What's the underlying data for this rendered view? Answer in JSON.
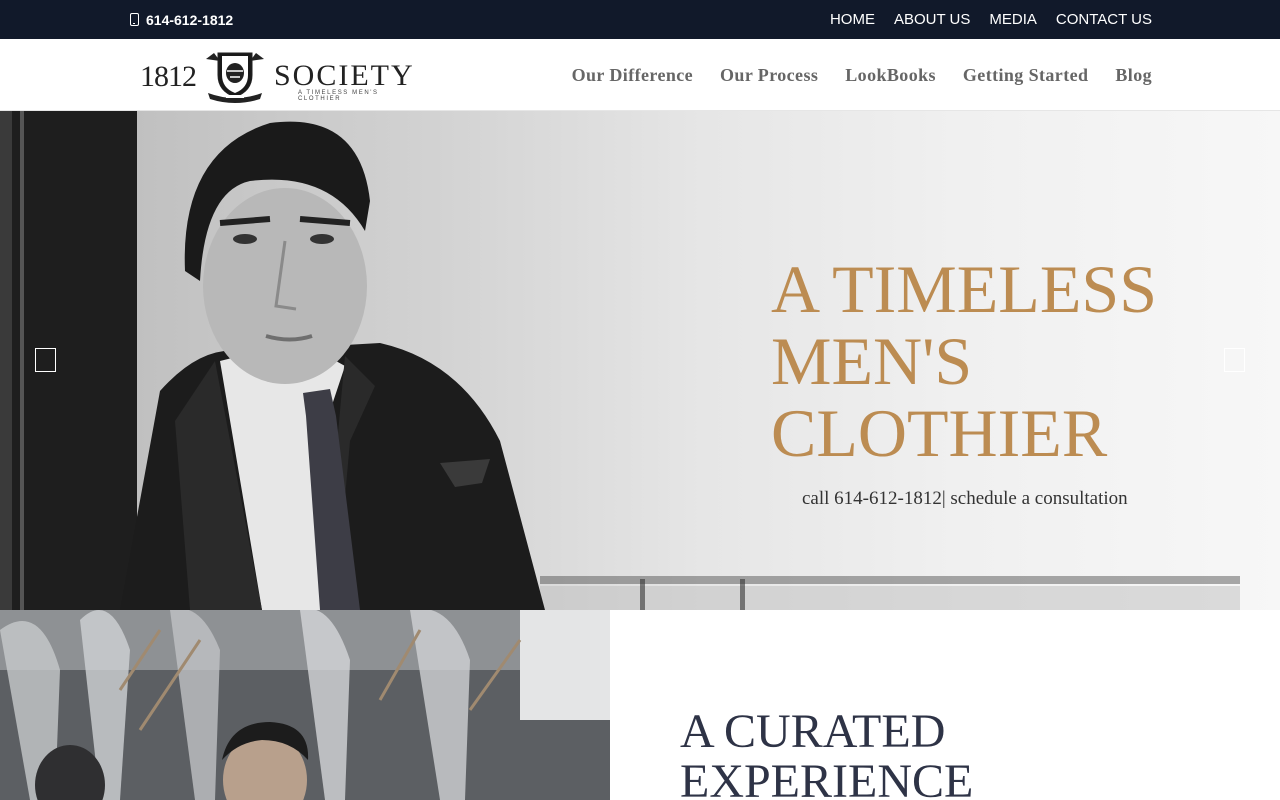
{
  "topbar": {
    "phone": "614-612-1812",
    "nav": [
      "HOME",
      "ABOUT US",
      "MEDIA",
      "CONTACT US"
    ]
  },
  "header": {
    "logo": {
      "number": "1812",
      "word": "Society",
      "tagline": "A TIMELESS MEN'S CLOTHIER"
    },
    "nav": [
      "Our Difference",
      "Our Process",
      "LookBooks",
      "Getting Started",
      "Blog"
    ]
  },
  "hero": {
    "title_lines": [
      "A TIMELESS",
      "MEN'S",
      "CLOTHIER"
    ],
    "subtitle": "call 614-612-1812| schedule a consultation",
    "prev_icon": "arrow-left-icon",
    "next_icon": "arrow-right-icon"
  },
  "section": {
    "heading_lines": [
      "A CURATED",
      "EXPERIENCE"
    ]
  },
  "colors": {
    "topbar_bg": "#11192a",
    "accent_gold": "#bc8c52",
    "heading_navy": "#2e3346",
    "nav_gray": "#666666"
  }
}
